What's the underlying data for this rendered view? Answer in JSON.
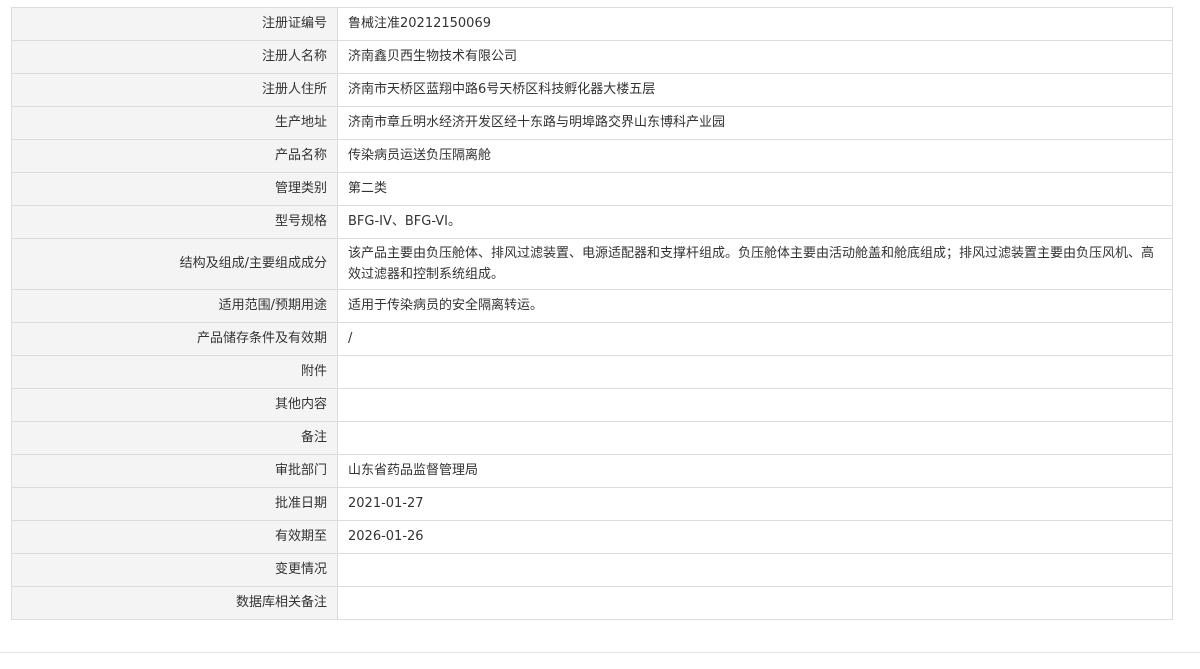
{
  "record": [
    {
      "label": "注册证编号",
      "value": "鲁械注准20212150069"
    },
    {
      "label": "注册人名称",
      "value": "济南鑫贝西生物技术有限公司"
    },
    {
      "label": "注册人住所",
      "value": "济南市天桥区蓝翔中路6号天桥区科技孵化器大楼五层"
    },
    {
      "label": "生产地址",
      "value": "济南市章丘明水经济开发区经十东路与明埠路交界山东博科产业园"
    },
    {
      "label": "产品名称",
      "value": "传染病员运送负压隔离舱"
    },
    {
      "label": "管理类别",
      "value": "第二类"
    },
    {
      "label": "型号规格",
      "value": "BFG-IV、BFG-VI。"
    },
    {
      "label": "结构及组成/主要组成成分",
      "value": "该产品主要由负压舱体、排风过滤装置、电源适配器和支撑杆组成。负压舱体主要由活动舱盖和舱底组成；排风过滤装置主要由负压风机、高效过滤器和控制系统组成。"
    },
    {
      "label": "适用范围/预期用途",
      "value": "适用于传染病员的安全隔离转运。"
    },
    {
      "label": "产品储存条件及有效期",
      "value": "/"
    },
    {
      "label": "附件",
      "value": ""
    },
    {
      "label": "其他内容",
      "value": ""
    },
    {
      "label": "备注",
      "value": ""
    },
    {
      "label": "审批部门",
      "value": "山东省药品监督管理局"
    },
    {
      "label": "批准日期",
      "value": "2021-01-27"
    },
    {
      "label": "有效期至",
      "value": "2026-01-26"
    },
    {
      "label": "变更情况",
      "value": ""
    },
    {
      "label": "数据库相关备注",
      "value": ""
    }
  ]
}
